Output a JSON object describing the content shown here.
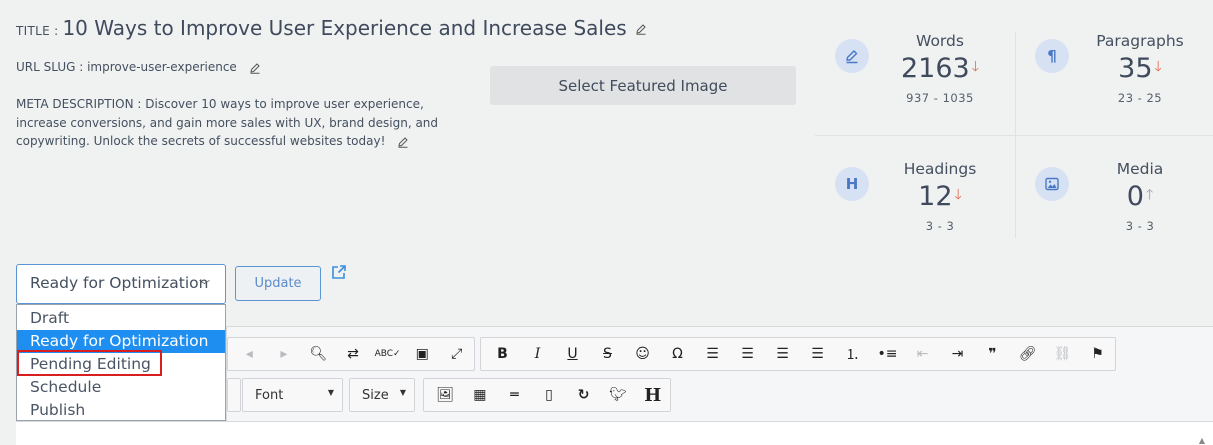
{
  "post": {
    "title_label": "TITLE :",
    "title": "10 Ways to Improve User Experience and Increase Sales",
    "slug_label": "URL SLUG :",
    "slug": "improve-user-experience",
    "meta_label": "META DESCRIPTION :",
    "meta": "Discover 10 ways to improve user experience, increase conversions, and gain more sales with UX, brand design, and copywriting. Unlock the secrets of successful websites today!"
  },
  "featured_image_button": "Select Featured Image",
  "stats": [
    {
      "label": "Words",
      "value": "2163",
      "range": "937 - 1035",
      "icon": "pencil-icon",
      "trend": "down"
    },
    {
      "label": "Paragraphs",
      "value": "35",
      "range": "23 - 25",
      "icon": "paragraph-icon",
      "trend": "down"
    },
    {
      "label": "Headings",
      "value": "12",
      "range": "3 - 3",
      "icon": "heading-icon",
      "trend": "down"
    },
    {
      "label": "Media",
      "value": "0",
      "range": "3 - 3",
      "icon": "image-icon",
      "trend": "up"
    }
  ],
  "status": {
    "selected": "Ready for Optimization",
    "options": [
      "Draft",
      "Ready for Optimization",
      "Pending Editing",
      "Schedule",
      "Publish"
    ]
  },
  "update_button": "Update",
  "toolbar": {
    "font_combo": "Font",
    "size_combo": "Size"
  },
  "colors": {
    "accent": "#1e8ff0",
    "highlight_border": "#d81e1e",
    "trend_down": "#e36a52"
  }
}
